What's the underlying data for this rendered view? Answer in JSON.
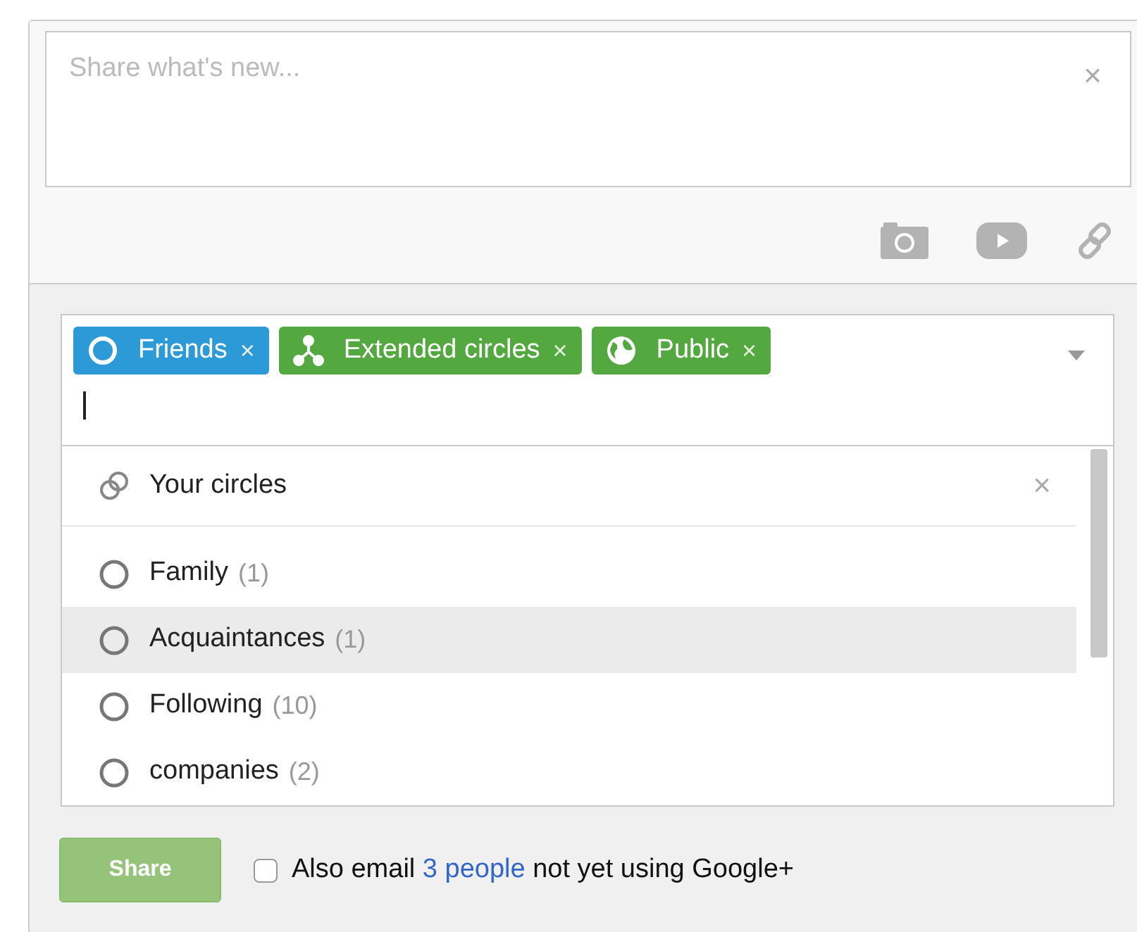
{
  "composer": {
    "placeholder": "Share what's new...",
    "close": "×"
  },
  "recipients": [
    {
      "label": "Friends",
      "kind": "circle",
      "color": "#2d9ad8",
      "remove": "×"
    },
    {
      "label": "Extended circles",
      "kind": "extended",
      "color": "#53a93f",
      "remove": "×"
    },
    {
      "label": "Public",
      "kind": "public",
      "color": "#53a93f",
      "remove": "×"
    }
  ],
  "dropdown": {
    "header": "Your circles",
    "close": "×",
    "items": [
      {
        "label": "Family",
        "count": "(1)",
        "selected": false
      },
      {
        "label": "Acquaintances",
        "count": "(1)",
        "selected": true
      },
      {
        "label": "Following",
        "count": "(10)",
        "selected": false
      },
      {
        "label": "companies",
        "count": "(2)",
        "selected": false
      }
    ]
  },
  "footer": {
    "share": "Share",
    "email_checked": false,
    "email_before": "Also email",
    "email_link": "3 people",
    "email_after": "not yet using Google+"
  }
}
